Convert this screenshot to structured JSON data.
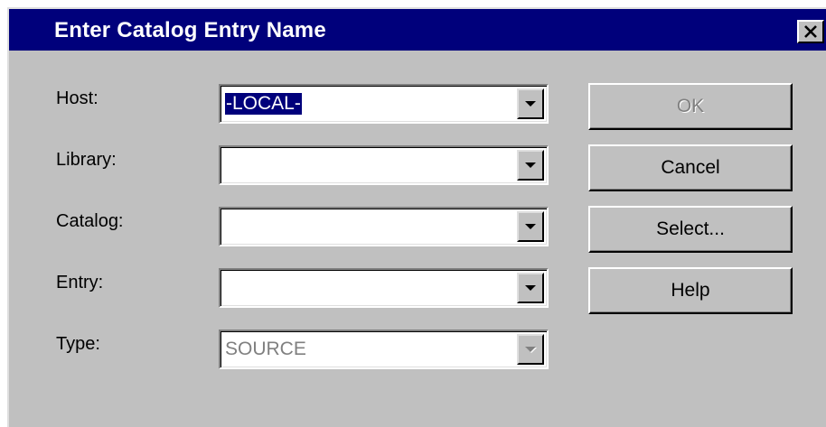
{
  "dialog": {
    "title": "Enter Catalog Entry Name",
    "close_icon": "close-icon"
  },
  "fields": {
    "host": {
      "label": "Host:",
      "value": "-LOCAL-"
    },
    "library": {
      "label": "Library:",
      "value": ""
    },
    "catalog": {
      "label": "Catalog:",
      "value": ""
    },
    "entry": {
      "label": "Entry:",
      "value": ""
    },
    "type": {
      "label": "Type:",
      "value": "SOURCE"
    }
  },
  "buttons": {
    "ok": "OK",
    "cancel": "Cancel",
    "select": "Select...",
    "help": "Help"
  },
  "colors": {
    "titlebar": "#00007b",
    "face": "#c0c0c0",
    "selection": "#00007b",
    "disabled_text": "#808080"
  }
}
